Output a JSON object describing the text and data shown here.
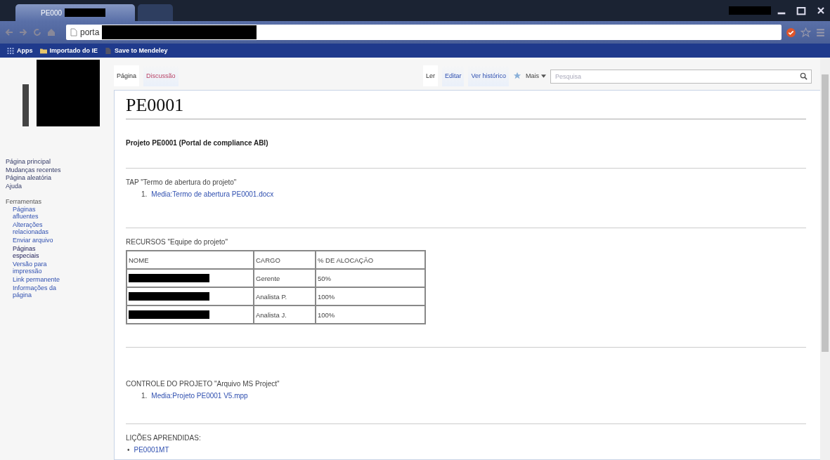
{
  "browser": {
    "tabs": [
      {
        "title": "PE000",
        "selected": true
      },
      {
        "selected": false
      }
    ],
    "address_bar": {
      "value": "porta"
    },
    "bookmarks": [
      {
        "kind": "apps",
        "label": "Apps"
      },
      {
        "kind": "folder",
        "label": "Importado do IE"
      },
      {
        "kind": "page",
        "label": "Save to Mendeley"
      }
    ]
  },
  "sidebar": {
    "navigation": [
      {
        "label": "Página principal"
      },
      {
        "label": "Mudanças recentes"
      },
      {
        "label": "Página aleatória"
      },
      {
        "label": "Ajuda"
      }
    ],
    "tools_heading": "Ferramentas",
    "tools": [
      {
        "label": "Páginas afluentes",
        "visited": false
      },
      {
        "label": "Alterações relacionadas",
        "visited": false
      },
      {
        "label": "Enviar arquivo",
        "visited": false
      },
      {
        "label": "Páginas especiais",
        "visited": true
      },
      {
        "label": "Versão para impressão",
        "visited": false
      },
      {
        "label": "Link permanente",
        "visited": false
      },
      {
        "label": "Informações da página",
        "visited": false
      }
    ]
  },
  "page_tabs": {
    "left": [
      {
        "label": "Página",
        "selected": true,
        "missing": false
      },
      {
        "label": "Discussão",
        "selected": false,
        "missing": true
      }
    ],
    "right": [
      {
        "label": "Ler",
        "selected": true
      },
      {
        "label": "Editar",
        "selected": false
      },
      {
        "label": "Ver histórico",
        "selected": false
      }
    ],
    "more": "Mais",
    "search": {
      "placeholder": "Pesquisa"
    }
  },
  "content": {
    "title": "PE0001",
    "subtitle": "Projeto PE0001  (Portal de compliance ABI)",
    "sections": [
      {
        "kind": "list",
        "heading": "TAP \"Termo de abertura do projeto\"",
        "items": [
          {
            "marker": "1.",
            "link": "Media:Termo de abertura PE0001.docx"
          }
        ]
      },
      {
        "kind": "table",
        "heading": "RECURSOS \"Equipe do projeto\"",
        "columns": [
          "NOME",
          "CARGO",
          "% DE ALOCAÇÃO"
        ],
        "rows": [
          {
            "role": "Gerente",
            "allocation": "50%"
          },
          {
            "role": "Analista P.",
            "allocation": "100%"
          },
          {
            "role": "Analista J.",
            "allocation": "100%"
          }
        ]
      },
      {
        "kind": "list",
        "heading": "CONTROLE DO PROJETO \"Arquivo MS Project\"",
        "items": [
          {
            "marker": "1.",
            "link": "Media:Projeto PE0001 V5.mpp"
          }
        ]
      },
      {
        "kind": "list",
        "heading": "LIÇÕES APRENDIDAS:",
        "items": [
          {
            "marker": "•",
            "link": "PE0001MT"
          }
        ]
      }
    ]
  }
}
